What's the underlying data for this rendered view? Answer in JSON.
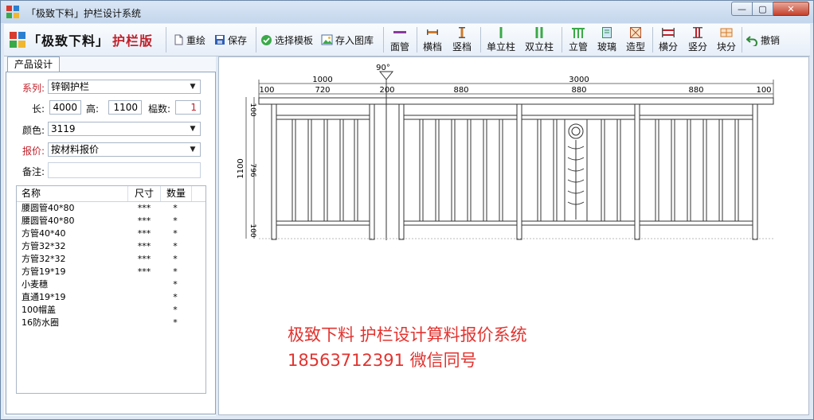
{
  "window": {
    "title": "「极致下料」护栏设计系统",
    "min_label": "—",
    "max_label": "▢",
    "close_label": "✕"
  },
  "toolbar": {
    "brand_name": "「极致下料」",
    "brand_sub": "护栏版",
    "buttons": {
      "redraw": "重绘",
      "save": "保存",
      "select_template": "选择模板",
      "save_to_library": "存入图库",
      "top_rail": "面管",
      "horizontal": "横档",
      "vertical": "竖档",
      "single_post": "单立柱",
      "double_post": "双立柱",
      "post": "立管",
      "glass": "玻璃",
      "shape": "造型",
      "h_split": "横分",
      "v_split": "竖分",
      "block_split": "块分",
      "undo": "撤销"
    }
  },
  "panel": {
    "tab": "产品设计",
    "series_label": "系列:",
    "series_value": "锌钢护栏",
    "length_label": "长:",
    "length_value": "4000",
    "height_label": "高:",
    "height_value": "1100",
    "panels_label": "榀数:",
    "panels_value": "1",
    "color_label": "颜色:",
    "color_value": "3119",
    "quote_label": "报价:",
    "quote_value": "按材料报价",
    "note_label": "备注:",
    "note_value": ""
  },
  "materials": {
    "headers": [
      "名称",
      "尺寸",
      "数量"
    ],
    "rows": [
      {
        "name": "腰圆管40*80",
        "size": "***",
        "qty": "*"
      },
      {
        "name": "腰圆管40*80",
        "size": "***",
        "qty": "*"
      },
      {
        "name": "方管40*40",
        "size": "***",
        "qty": "*"
      },
      {
        "name": "方管32*32",
        "size": "***",
        "qty": "*"
      },
      {
        "name": "方管32*32",
        "size": "***",
        "qty": "*"
      },
      {
        "name": "方管19*19",
        "size": "***",
        "qty": "*"
      },
      {
        "name": "小麦穗",
        "size": "",
        "qty": "*"
      },
      {
        "name": "直通19*19",
        "size": "",
        "qty": "*"
      },
      {
        "name": "100帽盖",
        "size": "",
        "qty": "*"
      },
      {
        "name": "16防水圈",
        "size": "",
        "qty": "*"
      }
    ]
  },
  "drawing": {
    "angle": "90°",
    "dim_top": [
      "1000",
      "3000"
    ],
    "dim_segments": [
      "100",
      "720",
      "200",
      "880",
      "880",
      "880",
      "100"
    ],
    "dim_left": [
      "100",
      "796",
      "100"
    ],
    "dim_total_height": "1100"
  },
  "promo": {
    "line1": "极致下料  护栏设计算料报价系统",
    "line2": "18563712391  微信同号"
  }
}
